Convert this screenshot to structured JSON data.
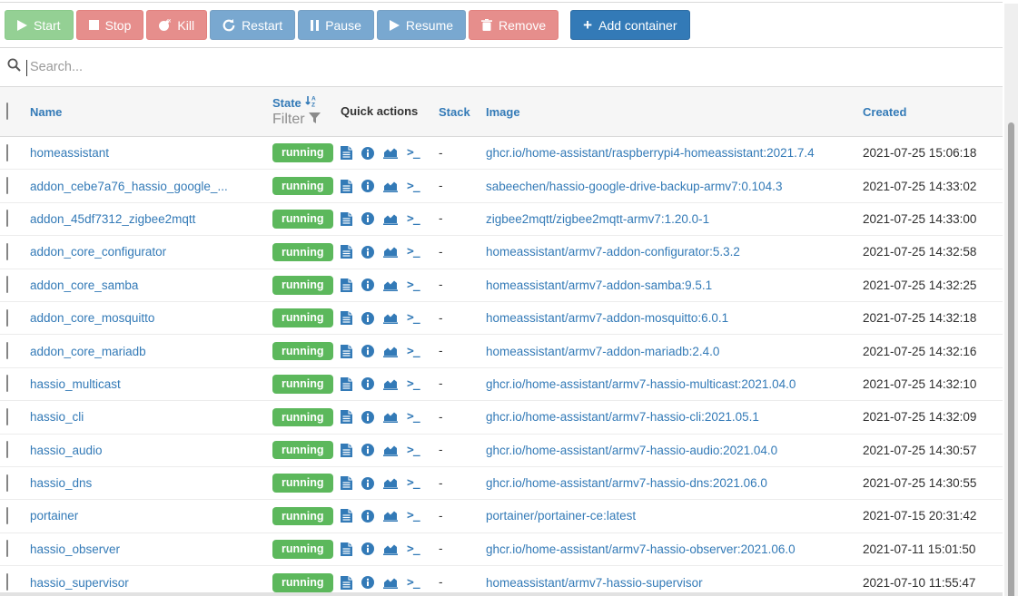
{
  "toolbar": {
    "buttons": [
      {
        "label": "Start",
        "style": "success",
        "icon": "play-icon"
      },
      {
        "label": "Stop",
        "style": "danger",
        "icon": "stop-icon"
      },
      {
        "label": "Kill",
        "style": "danger",
        "icon": "bomb-icon"
      },
      {
        "label": "Restart",
        "style": "primary",
        "icon": "restart-icon"
      },
      {
        "label": "Pause",
        "style": "primary",
        "icon": "pause-icon"
      },
      {
        "label": "Resume",
        "style": "primary",
        "icon": "play-icon"
      },
      {
        "label": "Remove",
        "style": "danger",
        "icon": "trash-icon"
      }
    ],
    "add_button": {
      "label": "Add container",
      "icon": "plus-icon"
    }
  },
  "search": {
    "placeholder": "Search..."
  },
  "table": {
    "headers": {
      "name": "Name",
      "state": "State",
      "state_filter": "Filter",
      "quick_actions": "Quick actions",
      "stack": "Stack",
      "image": "Image",
      "created": "Created"
    },
    "quick_action_icons": [
      "logs-icon",
      "inspect-icon",
      "stats-icon",
      "console-icon"
    ],
    "rows": [
      {
        "name": "homeassistant",
        "state": "running",
        "stack": "-",
        "image": "ghcr.io/home-assistant/raspberrypi4-homeassistant:2021.7.4",
        "created": "2021-07-25 15:06:18"
      },
      {
        "name": "addon_cebe7a76_hassio_google_...",
        "state": "running",
        "stack": "-",
        "image": "sabeechen/hassio-google-drive-backup-armv7:0.104.3",
        "created": "2021-07-25 14:33:02"
      },
      {
        "name": "addon_45df7312_zigbee2mqtt",
        "state": "running",
        "stack": "-",
        "image": "zigbee2mqtt/zigbee2mqtt-armv7:1.20.0-1",
        "created": "2021-07-25 14:33:00"
      },
      {
        "name": "addon_core_configurator",
        "state": "running",
        "stack": "-",
        "image": "homeassistant/armv7-addon-configurator:5.3.2",
        "created": "2021-07-25 14:32:58"
      },
      {
        "name": "addon_core_samba",
        "state": "running",
        "stack": "-",
        "image": "homeassistant/armv7-addon-samba:9.5.1",
        "created": "2021-07-25 14:32:25"
      },
      {
        "name": "addon_core_mosquitto",
        "state": "running",
        "stack": "-",
        "image": "homeassistant/armv7-addon-mosquitto:6.0.1",
        "created": "2021-07-25 14:32:18"
      },
      {
        "name": "addon_core_mariadb",
        "state": "running",
        "stack": "-",
        "image": "homeassistant/armv7-addon-mariadb:2.4.0",
        "created": "2021-07-25 14:32:16"
      },
      {
        "name": "hassio_multicast",
        "state": "running",
        "stack": "-",
        "image": "ghcr.io/home-assistant/armv7-hassio-multicast:2021.04.0",
        "created": "2021-07-25 14:32:10"
      },
      {
        "name": "hassio_cli",
        "state": "running",
        "stack": "-",
        "image": "ghcr.io/home-assistant/armv7-hassio-cli:2021.05.1",
        "created": "2021-07-25 14:32:09"
      },
      {
        "name": "hassio_audio",
        "state": "running",
        "stack": "-",
        "image": "ghcr.io/home-assistant/armv7-hassio-audio:2021.04.0",
        "created": "2021-07-25 14:30:57"
      },
      {
        "name": "hassio_dns",
        "state": "running",
        "stack": "-",
        "image": "ghcr.io/home-assistant/armv7-hassio-dns:2021.06.0",
        "created": "2021-07-25 14:30:55"
      },
      {
        "name": "portainer",
        "state": "running",
        "stack": "-",
        "image": "portainer/portainer-ce:latest",
        "created": "2021-07-15 20:31:42"
      },
      {
        "name": "hassio_observer",
        "state": "running",
        "stack": "-",
        "image": "ghcr.io/home-assistant/armv7-hassio-observer:2021.06.0",
        "created": "2021-07-11 15:01:50"
      },
      {
        "name": "hassio_supervisor",
        "state": "running",
        "stack": "-",
        "image": "homeassistant/armv7-hassio-supervisor",
        "created": "2021-07-10 11:55:47"
      }
    ]
  },
  "colors": {
    "accent": "#337ab7",
    "success": "#5cb85c",
    "danger": "#d9534f",
    "badge_running": "#5cb85c",
    "header_bg": "#f6f6f6"
  }
}
